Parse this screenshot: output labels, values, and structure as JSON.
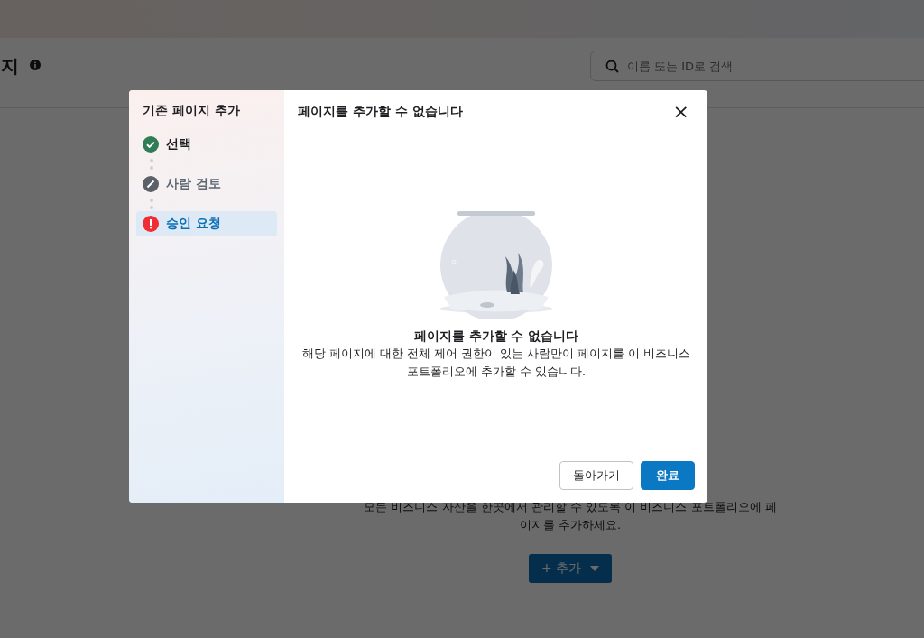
{
  "page": {
    "title": "지",
    "search": {
      "placeholder": "이름 또는 ID로 검색"
    },
    "empty_text": [
      "모든 비즈니스 자산을 한곳에서 관리할 수 있도록 이 비즈니스 포트폴리오에 페",
      "이지를 추가하세요."
    ],
    "add_button": "+ 추가"
  },
  "dialog": {
    "sidebar_title": "기존 페이지 추가",
    "steps": [
      {
        "label": "선택",
        "kind": "done",
        "selected": false
      },
      {
        "label": "사람 검토",
        "kind": "skipped",
        "selected": false
      },
      {
        "label": "승인 요청",
        "kind": "error",
        "selected": true
      }
    ],
    "title": "페이지를 추가할 수 없습니다",
    "close": "×",
    "message_title": "페이지를 추가할 수 없습니다",
    "message": "해당 페이지에 대한 전체 제어 권한이 있는 사람만이 페이지를 이 비즈니스 포트폴리오에 추가할 수 있습니다.",
    "buttons": [
      {
        "label": "돌아가기",
        "kind": "secondary"
      },
      {
        "label": "완료",
        "kind": "primary"
      }
    ]
  }
}
